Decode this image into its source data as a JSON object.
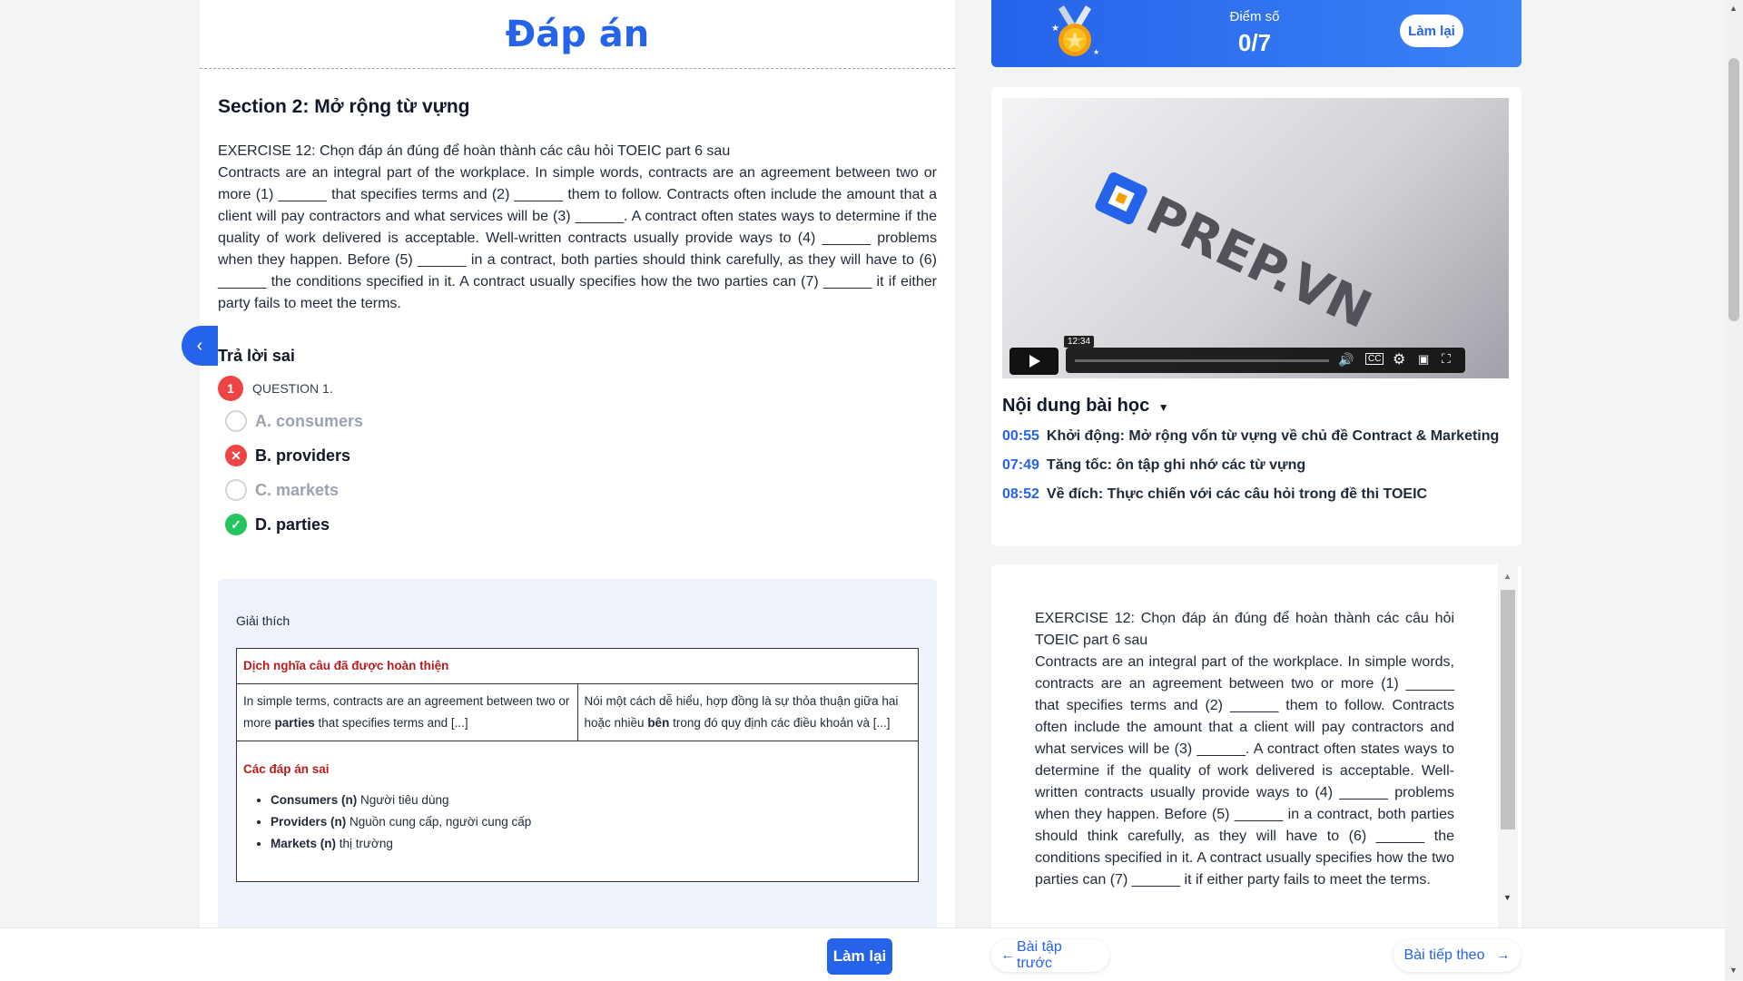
{
  "answer": {
    "title": "Đáp án"
  },
  "section": {
    "title": "Section 2: Mở rộng từ vựng"
  },
  "exercise": {
    "instruction": "EXERCISE 12: Chọn đáp án đúng để hoàn thành các câu hỏi TOEIC part 6 sau",
    "passage": "Contracts are an integral part of the workplace. In simple words, contracts are an agreement between two or more (1) ______ that specifies terms and (2) ______ them to follow. Contracts often include the amount that a client will pay contractors and what services will be (3) ______. A contract often states ways to determine if the quality of work delivered is acceptable. Well-written contracts usually provide ways to (4) ______ problems when they happen. Before (5) ______ in a contract, both parties should think carefully, as they will have to (6) ______ the conditions specified in it. A contract usually specifies how the two parties can (7) ______ it if either party fails to meet the terms."
  },
  "result": {
    "label": "Trả lời sai"
  },
  "question": {
    "number": "1",
    "label": "QUESTION 1.",
    "options": [
      {
        "label": "A. consumers",
        "state": "neutral"
      },
      {
        "label": "B. providers",
        "state": "wrong"
      },
      {
        "label": "C. markets",
        "state": "neutral"
      },
      {
        "label": "D. parties",
        "state": "correct"
      }
    ]
  },
  "explanation": {
    "title": "Giải thích",
    "translation_heading": "Dịch nghĩa câu đã được hoàn thiện",
    "en_before": "In simple terms, contracts are an agreement between two or more ",
    "en_bold": "parties",
    "en_after": " that specifies terms and [...]",
    "vi_before": "Nói một cách dễ hiểu, hợp đồng là sự thỏa thuận giữa hai hoặc nhiều ",
    "vi_bold": "bên",
    "vi_after": " trong đó quy định các điều khoản và [...]",
    "wrong_heading": "Các đáp án sai",
    "wrong_items": [
      {
        "term": "Consumers (n)",
        "meaning": " Người tiêu dùng"
      },
      {
        "term": "Providers (n)",
        "meaning": " Nguồn cung cấp, người cung cấp"
      },
      {
        "term": "Markets (n)",
        "meaning": " thị trường"
      }
    ]
  },
  "score": {
    "label": "Điểm số",
    "value": "0/7",
    "redo": "Làm lại"
  },
  "video": {
    "brand": "PREP.VN",
    "tooltip": "12:34",
    "progress": 0
  },
  "lesson": {
    "title": "Nội dung bài học",
    "items": [
      {
        "time": "00:55",
        "text": "Khởi động: Mở rộng vốn từ vựng về chủ đề Contract & Marketing"
      },
      {
        "time": "07:49",
        "text": "Tăng tốc: ôn tập ghi nhớ các từ vựng"
      },
      {
        "time": "08:52",
        "text": "Về đích: Thực chiến với các câu hỏi trong đề thi TOEIC"
      }
    ]
  },
  "footer": {
    "redo": "Làm lại",
    "prev": "Bài tập trước",
    "next": "Bài tiếp theo"
  },
  "colors": {
    "accent": "#2563eb",
    "wrong": "#ef4444",
    "correct": "#22c55e"
  },
  "icons": [
    "chevron-left-icon",
    "medal-icon",
    "play-icon",
    "volume-icon",
    "cc-icon",
    "settings-icon",
    "pip-icon",
    "fullscreen-icon",
    "caret-down-icon",
    "arrow-left-icon",
    "arrow-right-icon"
  ]
}
